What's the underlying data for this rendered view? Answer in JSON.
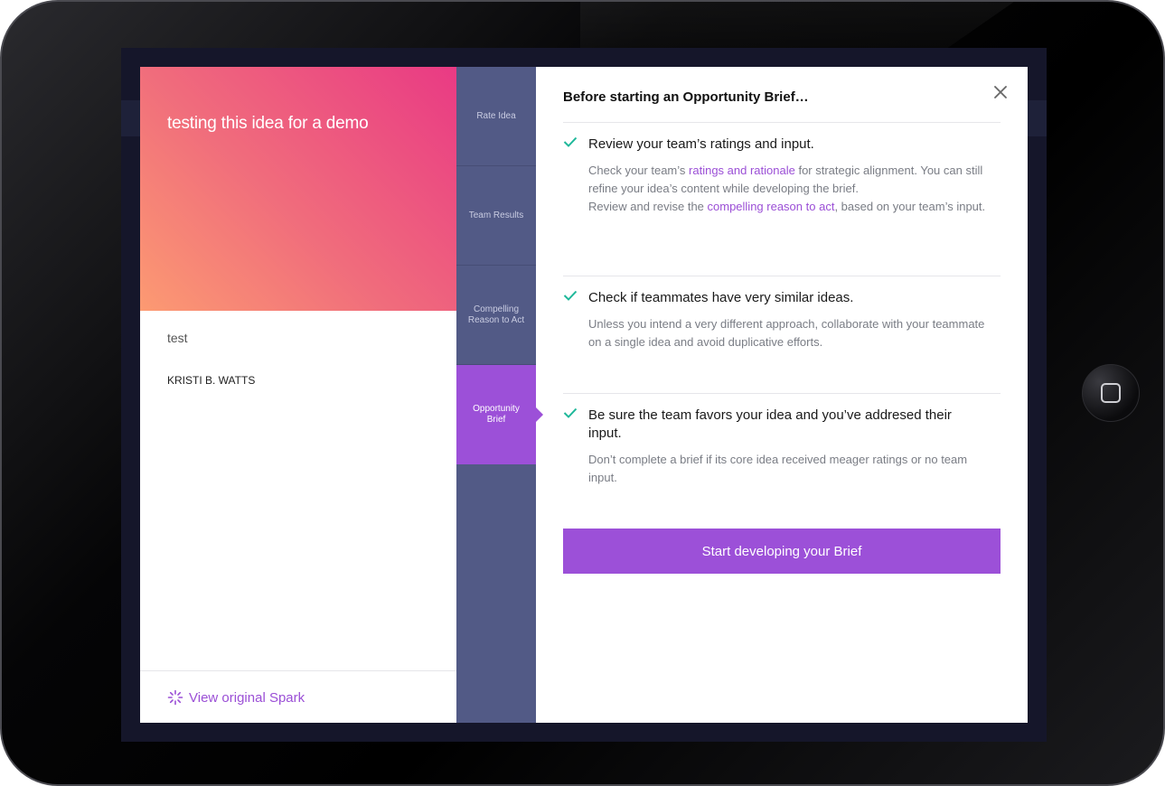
{
  "idea": {
    "title": "testing this idea for a demo",
    "description": "test",
    "author": "KRISTI B. WATTS",
    "view_spark_label": "View original Spark"
  },
  "steps": [
    {
      "label": "Rate Idea",
      "active": false
    },
    {
      "label": "Team Results",
      "active": false
    },
    {
      "label": "Compelling Reason to Act",
      "active": false
    },
    {
      "label": "Opportunity Brief",
      "active": true
    }
  ],
  "brief": {
    "heading": "Before starting an Opportunity Brief…",
    "items": [
      {
        "title": "Review your team’s ratings and input.",
        "body_1_pre": "Check your team’s ",
        "body_1_link": "ratings and rationale",
        "body_1_post": " for strategic alignment. You can still refine your idea’s content while developing the brief.",
        "body_2_pre": "Review and revise the ",
        "body_2_link": "compelling reason to act",
        "body_2_post": ", based on your team’s input."
      },
      {
        "title": "Check if teammates have very similar ideas.",
        "body": "Unless you intend a very different approach, collaborate with your teammate on a single idea and avoid duplicative efforts."
      },
      {
        "title": "Be sure the team favors your idea and you’ve addresed their input.",
        "body": "Don’t complete a brief if its core idea received meager ratings or no team input."
      }
    ],
    "cta_label": "Start developing your Brief"
  },
  "colors": {
    "accent": "#9c50d8",
    "rail": "#525a86",
    "check": "#1fb89a"
  },
  "icons": [
    "close-icon",
    "check-icon",
    "spark-icon",
    "home-button-icon"
  ]
}
